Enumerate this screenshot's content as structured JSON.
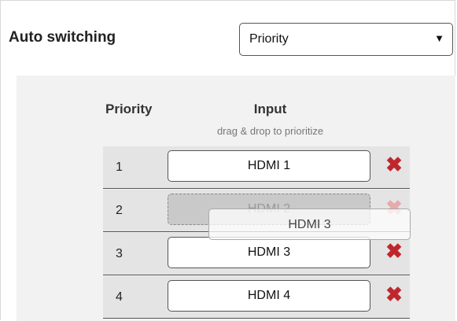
{
  "auto_switching": {
    "label": "Auto switching",
    "mode_value": "Priority",
    "dropdown_arrow": "▼"
  },
  "table": {
    "priority_header": "Priority",
    "input_header": "Input",
    "hint": "drag & drop to prioritize",
    "rows": [
      {
        "priority": "1",
        "input": "HDMI 1"
      },
      {
        "priority": "2",
        "input": "HDMI 2"
      },
      {
        "priority": "3",
        "input": "HDMI 3"
      },
      {
        "priority": "4",
        "input": "HDMI 4"
      }
    ],
    "remove_glyph": "✖"
  },
  "dragging": {
    "label": "HDMI 3"
  },
  "icons": {
    "remove": "close-icon",
    "dropdown": "chevron-down-icon"
  },
  "colors": {
    "remove_red": "#c0272d",
    "panel_bg": "#f2f2f2",
    "row_bg": "#e4e4e4"
  }
}
